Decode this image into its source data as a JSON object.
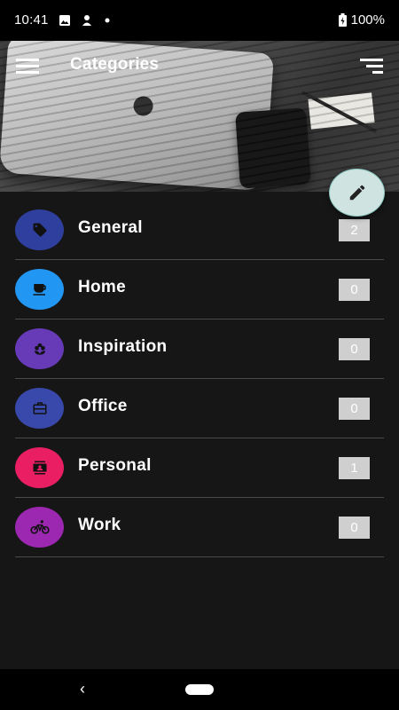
{
  "status_bar": {
    "time": "10:41",
    "battery": "100%"
  },
  "header": {
    "title": "Categories"
  },
  "categories": [
    {
      "label": "General",
      "count": "2",
      "color": "#2f3f9e",
      "icon": "tag-icon"
    },
    {
      "label": "Home",
      "count": "0",
      "color": "#2196f3",
      "icon": "coffee-cup-icon"
    },
    {
      "label": "Inspiration",
      "count": "0",
      "color": "#673ab7",
      "icon": "flower-icon"
    },
    {
      "label": "Office",
      "count": "0",
      "color": "#3949ab",
      "icon": "briefcase-icon"
    },
    {
      "label": "Personal",
      "count": "1",
      "color": "#e91e63",
      "icon": "contact-card-icon"
    },
    {
      "label": "Work",
      "count": "0",
      "color": "#9c27b0",
      "icon": "bicycle-icon"
    }
  ],
  "navbar": {
    "back_glyph": "‹"
  }
}
